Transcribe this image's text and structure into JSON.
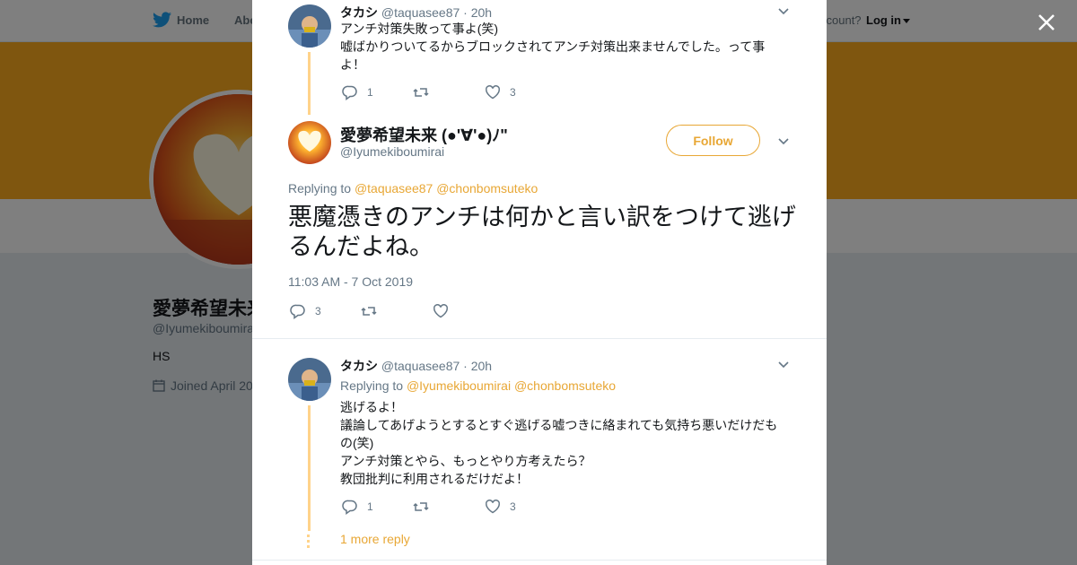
{
  "background": {
    "nav": {
      "home": "Home",
      "about": "Abo",
      "account": "ccount?",
      "login": "Log in"
    },
    "profile": {
      "name": "愛夢希望未来",
      "handle": "@Iyumekiboumirai",
      "bio": "HS",
      "joined": "Joined April 20"
    }
  },
  "thread": {
    "parent": {
      "name": "タカシ",
      "handle": "@taquasee87",
      "time": "20h",
      "line1": "アンチ対策失敗って事よ(笑)",
      "line2": "嘘ばかりついてるからブロックされてアンチ対策出来ませんでした。って事よ！",
      "replies": "1",
      "retweets": "",
      "likes": "3"
    },
    "main": {
      "name": "愛夢希望未来 (●'∀'●)ﾉ\"",
      "handle": "@Iyumekiboumirai",
      "follow": "Follow",
      "replying_prefix": "Replying to",
      "replying_to_1": "@taquasee87",
      "replying_to_2": "@chonbomsuteko",
      "text": "悪魔憑きのアンチは何かと言い訳をつけて逃げるんだよね。",
      "timestamp": "11:03 AM - 7 Oct 2019",
      "replies": "3",
      "retweets": "",
      "likes": ""
    },
    "reply": {
      "name": "タカシ",
      "handle": "@taquasee87",
      "time": "20h",
      "replying_prefix": "Replying to",
      "replying_to_1": "@Iyumekiboumirai",
      "replying_to_2": "@chonbomsuteko",
      "line1": "逃げるよ！",
      "line2": "議論してあげようとするとすぐ逃げる嘘つきに絡まれても気持ち悪いだけだもの(笑)",
      "line3": "アンチ対策とやら、もっとやり方考えたら？",
      "line4": "教団批判に利用されるだけだよ！",
      "replies": "1",
      "retweets": "",
      "likes": "3",
      "more": "1 more reply"
    }
  },
  "colors": {
    "accent": "#e8a735",
    "banner": "#ffad1f",
    "thread_line": "#ffd38a"
  },
  "icons": [
    "twitter-bird-icon",
    "close-icon",
    "reply-icon",
    "retweet-icon",
    "like-icon",
    "chevron-down-icon",
    "calendar-icon"
  ]
}
